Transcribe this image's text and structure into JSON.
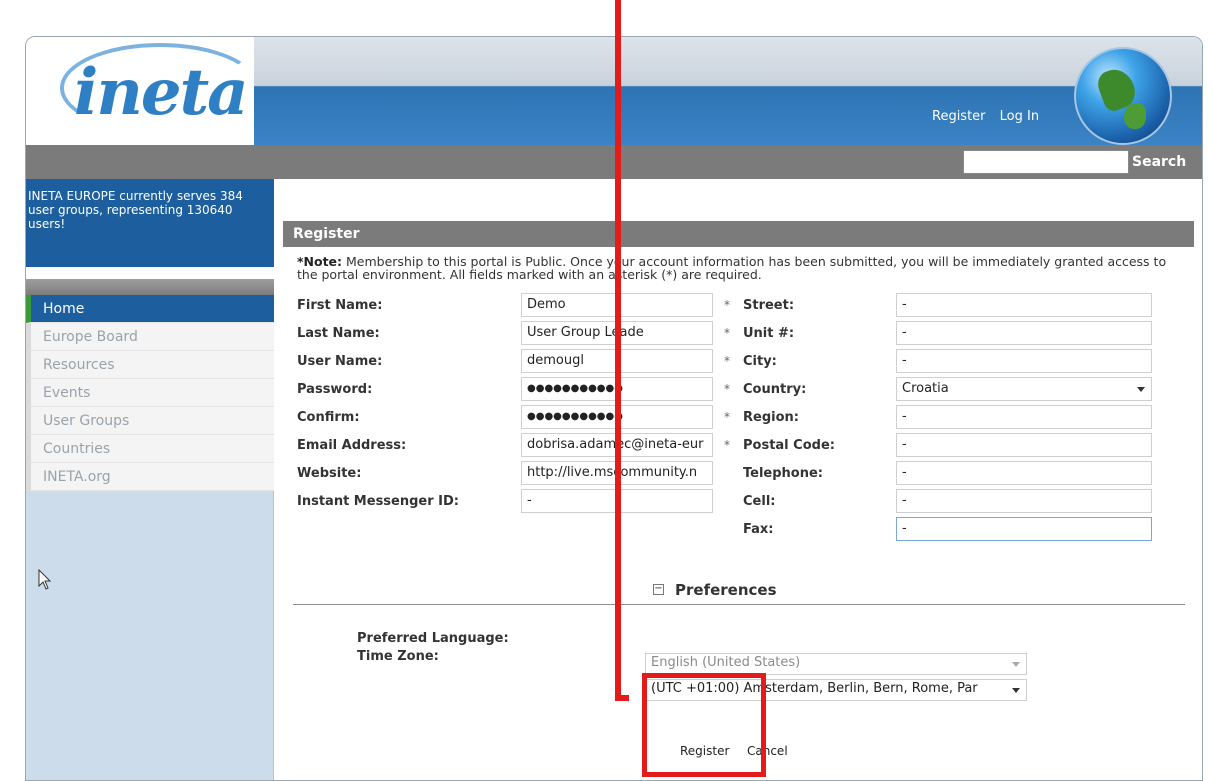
{
  "header": {
    "logo_text": "ineta",
    "register_link": "Register",
    "login_link": "Log In"
  },
  "search": {
    "value": "",
    "button_label": "Search"
  },
  "sidebar": {
    "info_text": "INETA EUROPE currently serves 384 user groups, representing 130640 users!",
    "items": [
      {
        "label": "Home",
        "active": true
      },
      {
        "label": "Europe Board",
        "active": false
      },
      {
        "label": "Resources",
        "active": false
      },
      {
        "label": "Events",
        "active": false
      },
      {
        "label": "User Groups",
        "active": false
      },
      {
        "label": "Countries",
        "active": false
      },
      {
        "label": "INETA.org",
        "active": false
      }
    ]
  },
  "form": {
    "title": "Register",
    "note_bold": "*Note:",
    "note_text": " Membership to this portal is Public. Once your account information has been submitted, you will be immediately granted access to the portal environment. All fields marked with an asterisk (*) are required.",
    "left_fields": [
      {
        "label": "First Name:",
        "value": "Demo",
        "required": true
      },
      {
        "label": "Last Name:",
        "value": "User Group Leade",
        "required": true
      },
      {
        "label": "User Name:",
        "value": "demougl",
        "required": true
      },
      {
        "label": "Password:",
        "value": "●●●●●●●●●●●",
        "required": true
      },
      {
        "label": "Confirm:",
        "value": "●●●●●●●●●●●",
        "required": true
      },
      {
        "label": "Email Address:",
        "value": "dobrisa.adamec@ineta-eur",
        "required": true
      },
      {
        "label": "Website:",
        "value": "http://live.mscommunity.n",
        "required": false
      },
      {
        "label": "Instant Messenger ID:",
        "value": "-",
        "required": false
      }
    ],
    "right_fields": [
      {
        "label": "Street:",
        "value": "-"
      },
      {
        "label": "Unit #:",
        "value": "-"
      },
      {
        "label": "City:",
        "value": "-"
      },
      {
        "label": "Country:",
        "value": "Croatia"
      },
      {
        "label": "Region:",
        "value": "-"
      },
      {
        "label": "Postal Code:",
        "value": "-"
      },
      {
        "label": "Telephone:",
        "value": "-"
      },
      {
        "label": "Cell:",
        "value": "-"
      },
      {
        "label": "Fax:",
        "value": "-"
      }
    ],
    "preferences": {
      "title": "Preferences",
      "toggle": "−",
      "language_label": "Preferred Language:",
      "language_value": "English (United States)",
      "timezone_label": "Time Zone:",
      "timezone_value": "(UTC +01:00) Amsterdam, Berlin, Bern, Rome, Par"
    },
    "register_button": "Register",
    "cancel_button": "Cancel"
  },
  "colors": {
    "accent_blue": "#1c5e9e",
    "annotation_red": "#e31b1b"
  }
}
